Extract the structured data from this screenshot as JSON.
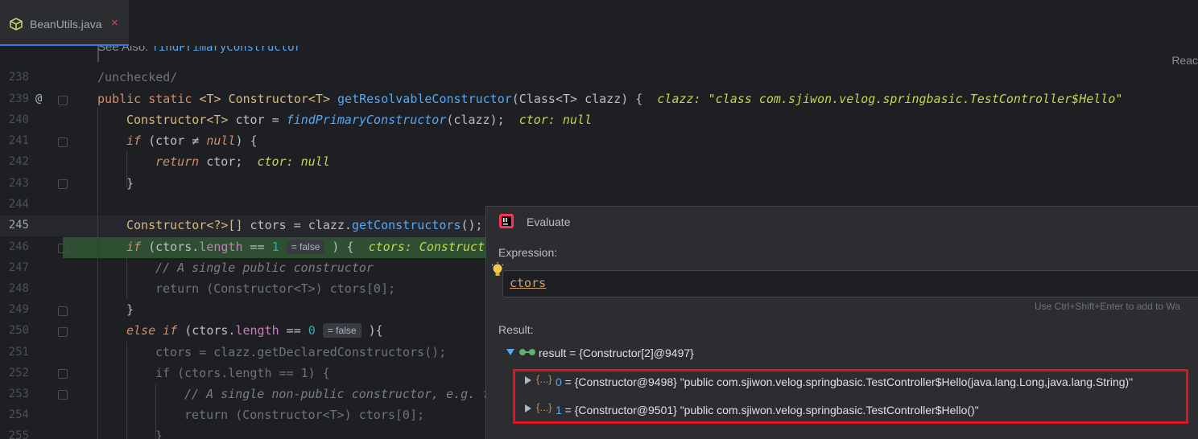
{
  "tab": {
    "file_name": "BeanUtils.java",
    "close_glyph": "×",
    "icon": "java-class-icon"
  },
  "reader_mode": "Reac",
  "doc": {
    "see_also_label": "See Also:",
    "see_also_link": "findPrimaryConstructor"
  },
  "lines": [
    {
      "num": "238"
    },
    {
      "num": "239",
      "marker": "@"
    },
    {
      "num": "240"
    },
    {
      "num": "241"
    },
    {
      "num": "242"
    },
    {
      "num": "243"
    },
    {
      "num": "244"
    },
    {
      "num": "245"
    },
    {
      "num": "246"
    },
    {
      "num": "247"
    },
    {
      "num": "248"
    },
    {
      "num": "249"
    },
    {
      "num": "250"
    },
    {
      "num": "251"
    },
    {
      "num": "252"
    },
    {
      "num": "253"
    },
    {
      "num": "254"
    },
    {
      "num": "255"
    }
  ],
  "code": {
    "l238": "/unchecked/",
    "l239_kw1": "public",
    "l239_kw2": "static",
    "l239_g1": "<T>",
    "l239_type": "Constructor",
    "l239_g2": "<T>",
    "l239_fn": "getResolvableConstructor",
    "l239_args": "(Class<T> clazz) {",
    "l239_dbg": "clazz: \"class com.sjiwon.velog.springbasic.TestController$Hello\"",
    "l240_type": "Constructor",
    "l240_g": "<T>",
    "l240_var": " ctor = ",
    "l240_fn": "findPrimaryConstructor",
    "l240_rest": "(clazz);",
    "l240_dbg": "ctor: null",
    "l241_kw": "if",
    "l241_a": " (ctor ",
    "l241_op": "≠",
    "l241_sp": " ",
    "l241_null": "null",
    "l241_b": ") {",
    "l242_kw": "return",
    "l242_rest": " ctor;",
    "l242_dbg": "ctor: null",
    "l243": "}",
    "l245_type": "Constructor",
    "l245_g": "<?>[]",
    "l245_a": " ctors = clazz.",
    "l245_fn": "getConstructors",
    "l245_b": "();",
    "l246_kw": "if",
    "l246_a": " (ctors.",
    "l246_fld": "length",
    "l246_op": " == ",
    "l246_num": "1",
    "l246_inlay": "= false",
    "l246_b": ") {",
    "l246_dbg": "ctors: Constructo",
    "l247": "// A single public constructor",
    "l248": "return (Constructor<T>) ctors[0];",
    "l249": "}",
    "l250_kw1": "else",
    "l250_kw2": "if",
    "l250_a": " (ctors.",
    "l250_fld": "length",
    "l250_op": " == ",
    "l250_num": "0",
    "l250_inlay": "= false",
    "l250_b": "){",
    "l251": "ctors = clazz.getDeclaredConstructors();",
    "l252": "if (ctors.length == 1) {",
    "l253": "// A single non-public constructor, e.g. f",
    "l254": "return (Constructor<T>) ctors[0];",
    "l255": "}"
  },
  "evaluate": {
    "title": "Evaluate",
    "expression_label": "Expression:",
    "expression_value": "ctors",
    "hint": "Use Ctrl+Shift+Enter to add to Wa",
    "result_label": "Result:",
    "result_root": "result = {Constructor[2]@9497}",
    "items": [
      {
        "index": "0",
        "text": " = {Constructor@9498} \"public com.sjiwon.velog.springbasic.TestController$Hello(java.lang.Long,java.lang.String)\""
      },
      {
        "index": "1",
        "text": " = {Constructor@9501} \"public com.sjiwon.velog.springbasic.TestController$Hello()\""
      }
    ],
    "field_icon_glyph": "{...}",
    "accent": "#e0141c"
  }
}
